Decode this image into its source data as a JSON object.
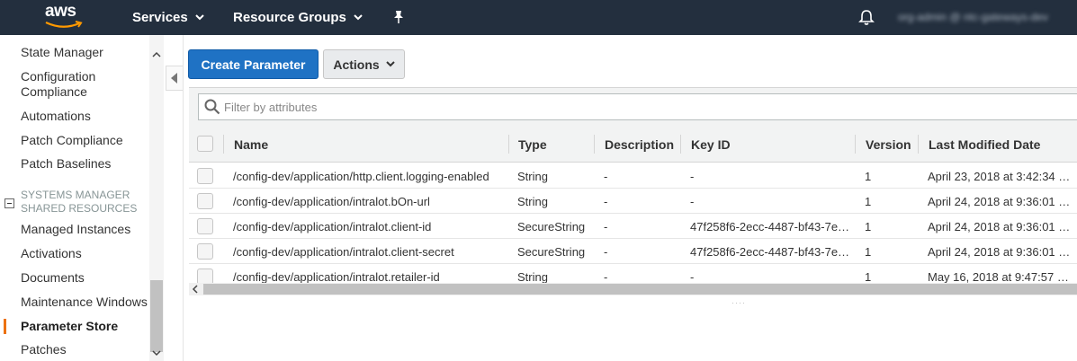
{
  "topnav": {
    "logo": "aws",
    "services": "Services",
    "resource_groups": "Resource Groups",
    "user": "org-admin @ ntc-gateways-dev"
  },
  "sidebar": {
    "items_top": [
      "State Manager",
      "Configuration Compliance",
      "Automations",
      "Patch Compliance",
      "Patch Baselines"
    ],
    "section": "SYSTEMS MANAGER SHARED RESOURCES",
    "items_shared": [
      "Managed Instances",
      "Activations",
      "Documents",
      "Maintenance Windows",
      "Parameter Store",
      "Patches"
    ],
    "active": "Parameter Store"
  },
  "toolbar": {
    "create": "Create Parameter",
    "actions": "Actions"
  },
  "filter": {
    "placeholder": "Filter by attributes"
  },
  "table": {
    "columns": [
      "Name",
      "Type",
      "Description",
      "Key ID",
      "Version",
      "Last Modified Date"
    ],
    "rows": [
      [
        "/config-dev/application/http.client.logging-enabled",
        "String",
        "-",
        "-",
        "1",
        "April 23, 2018 at 3:42:34 …"
      ],
      [
        "/config-dev/application/intralot.bOn-url",
        "String",
        "-",
        "-",
        "1",
        "April 24, 2018 at 9:36:01 …"
      ],
      [
        "/config-dev/application/intralot.client-id",
        "SecureString",
        "-",
        "47f258f6-2ecc-4487-bf43-7e…",
        "1",
        "April 24, 2018 at 9:36:01 …"
      ],
      [
        "/config-dev/application/intralot.client-secret",
        "SecureString",
        "-",
        "47f258f6-2ecc-4487-bf43-7e…",
        "1",
        "April 24, 2018 at 9:36:01 …"
      ],
      [
        "/config-dev/application/intralot.retailer-id",
        "String",
        "-",
        "-",
        "1",
        "May 16, 2018 at 9:47:57 …"
      ]
    ]
  },
  "colors": {
    "nav_bg": "#232f3e",
    "primary": "#1f72c4",
    "active_indicator": "#ec7211"
  }
}
